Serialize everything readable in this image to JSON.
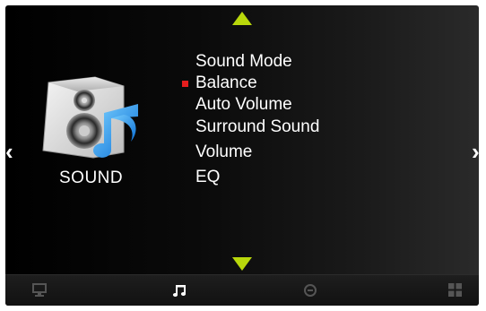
{
  "category": {
    "label": "SOUND",
    "icon": "speaker-music-note-icon"
  },
  "menu": {
    "items": [
      {
        "label": "Sound Mode",
        "selected": false
      },
      {
        "label": "Balance",
        "selected": true
      },
      {
        "label": "Auto Volume",
        "selected": false
      },
      {
        "label": "Surround Sound",
        "selected": false
      },
      {
        "label": "Volume",
        "selected": false
      },
      {
        "label": "EQ",
        "selected": false
      }
    ]
  },
  "navigation": {
    "left_glyph": "‹",
    "right_glyph": "›",
    "scroll_up_icon": "triangle-up-icon",
    "scroll_down_icon": "triangle-down-icon"
  },
  "bottom_tabs": [
    {
      "name": "picture",
      "icon": "monitor-icon",
      "active": false
    },
    {
      "name": "sound",
      "icon": "music-note-icon",
      "active": true
    },
    {
      "name": "time",
      "icon": "clock-icon",
      "active": false
    },
    {
      "name": "setup",
      "icon": "grid-icon",
      "active": false
    }
  ],
  "colors": {
    "accent": "#b9d80b",
    "selection": "#e51d1d",
    "text": "#ffffff",
    "inactive_icon": "#555555"
  }
}
